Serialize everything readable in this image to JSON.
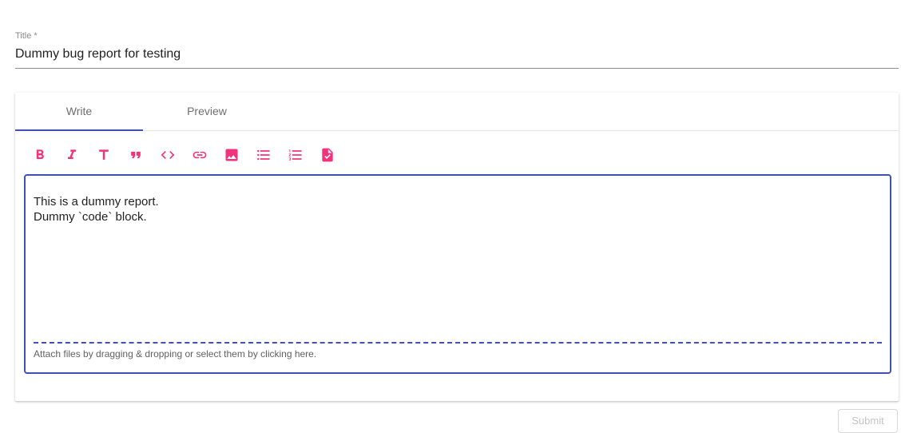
{
  "title_field": {
    "label": "Title *",
    "value": "Dummy bug report for testing"
  },
  "tabs": [
    {
      "label": "Write",
      "active": true
    },
    {
      "label": "Preview",
      "active": false
    }
  ],
  "toolbar": {
    "accent_color": "#f0337a",
    "icons": [
      "bold-icon",
      "italic-icon",
      "header-icon",
      "quote-icon",
      "code-icon",
      "link-icon",
      "image-icon",
      "unordered-list-icon",
      "ordered-list-icon",
      "task-list-icon"
    ]
  },
  "editor": {
    "lines": [
      "This is a dummy report.",
      "Dummy `code` block."
    ],
    "border_color": "#3f51b5"
  },
  "dropzone": {
    "text": "Attach files by dragging & dropping or select them by clicking here."
  },
  "submit": {
    "label": "Submit"
  }
}
